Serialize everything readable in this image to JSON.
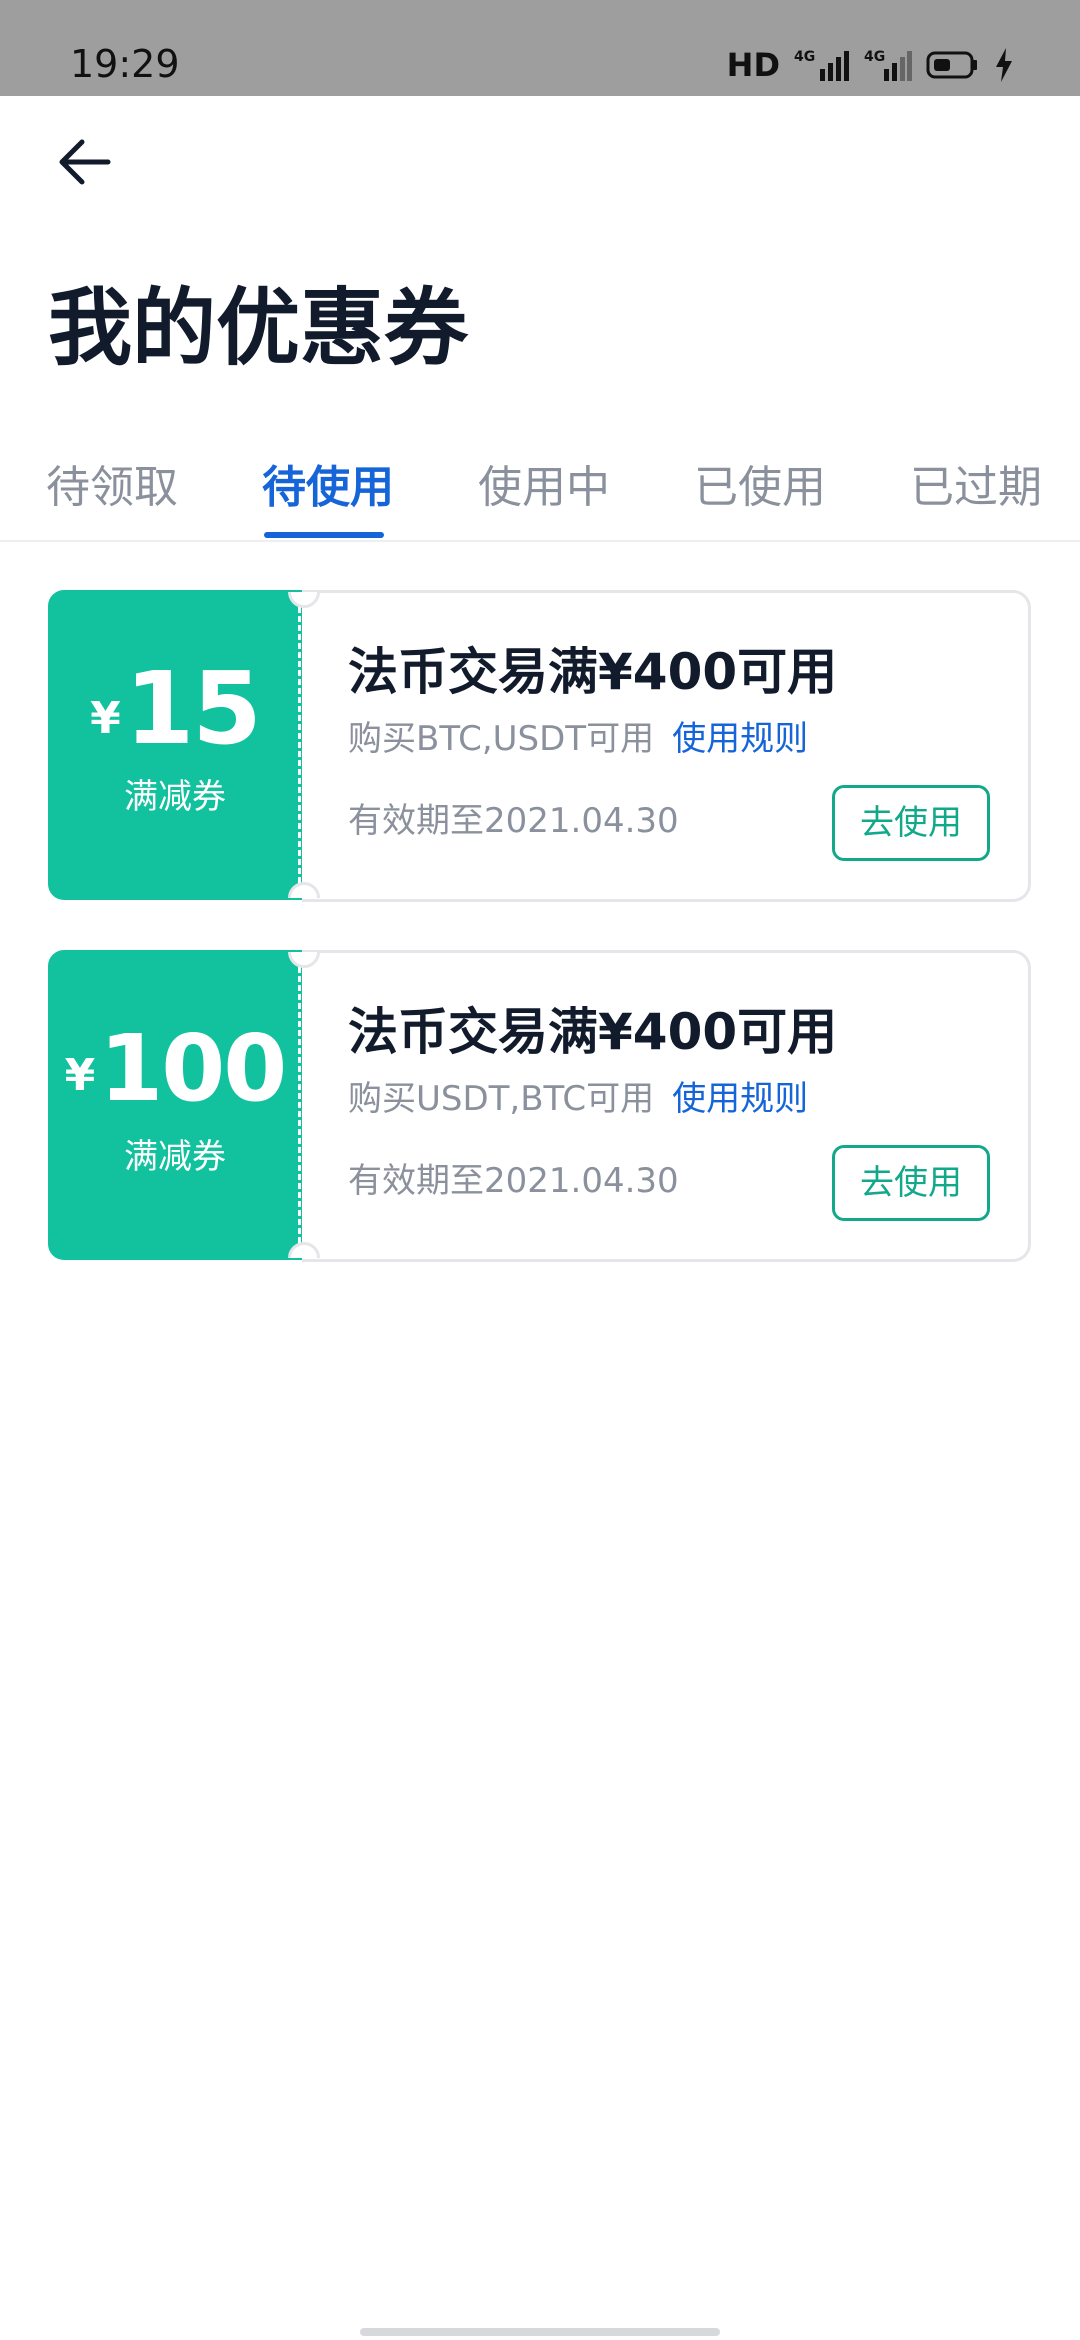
{
  "status_bar": {
    "time": "19:29",
    "hd_label": "HD",
    "network_1": "4G",
    "network_2": "4G"
  },
  "header": {
    "back_icon": "arrow-left-icon",
    "title": "我的优惠券"
  },
  "tabs": [
    {
      "label": "待领取",
      "active": false
    },
    {
      "label": "待使用",
      "active": true
    },
    {
      "label": "使用中",
      "active": false
    },
    {
      "label": "已使用",
      "active": false
    },
    {
      "label": "已过期",
      "active": false
    }
  ],
  "coupons": [
    {
      "currency": "¥",
      "value": "15",
      "type": "满减券",
      "title": "法币交易满¥400可用",
      "desc": "购买BTC,USDT可用",
      "rule_link": "使用规则",
      "expiry": "有效期至2021.04.30",
      "use_button": "去使用"
    },
    {
      "currency": "¥",
      "value": "100",
      "type": "满减券",
      "title": "法币交易满¥400可用",
      "desc": "购买USDT,BTC可用",
      "rule_link": "使用规则",
      "expiry": "有效期至2021.04.30",
      "use_button": "去使用"
    }
  ],
  "colors": {
    "accent_green": "#12c29f",
    "active_tab_blue": "#1565d8",
    "text_dark": "#111b2b",
    "text_gray": "#8a919d"
  }
}
